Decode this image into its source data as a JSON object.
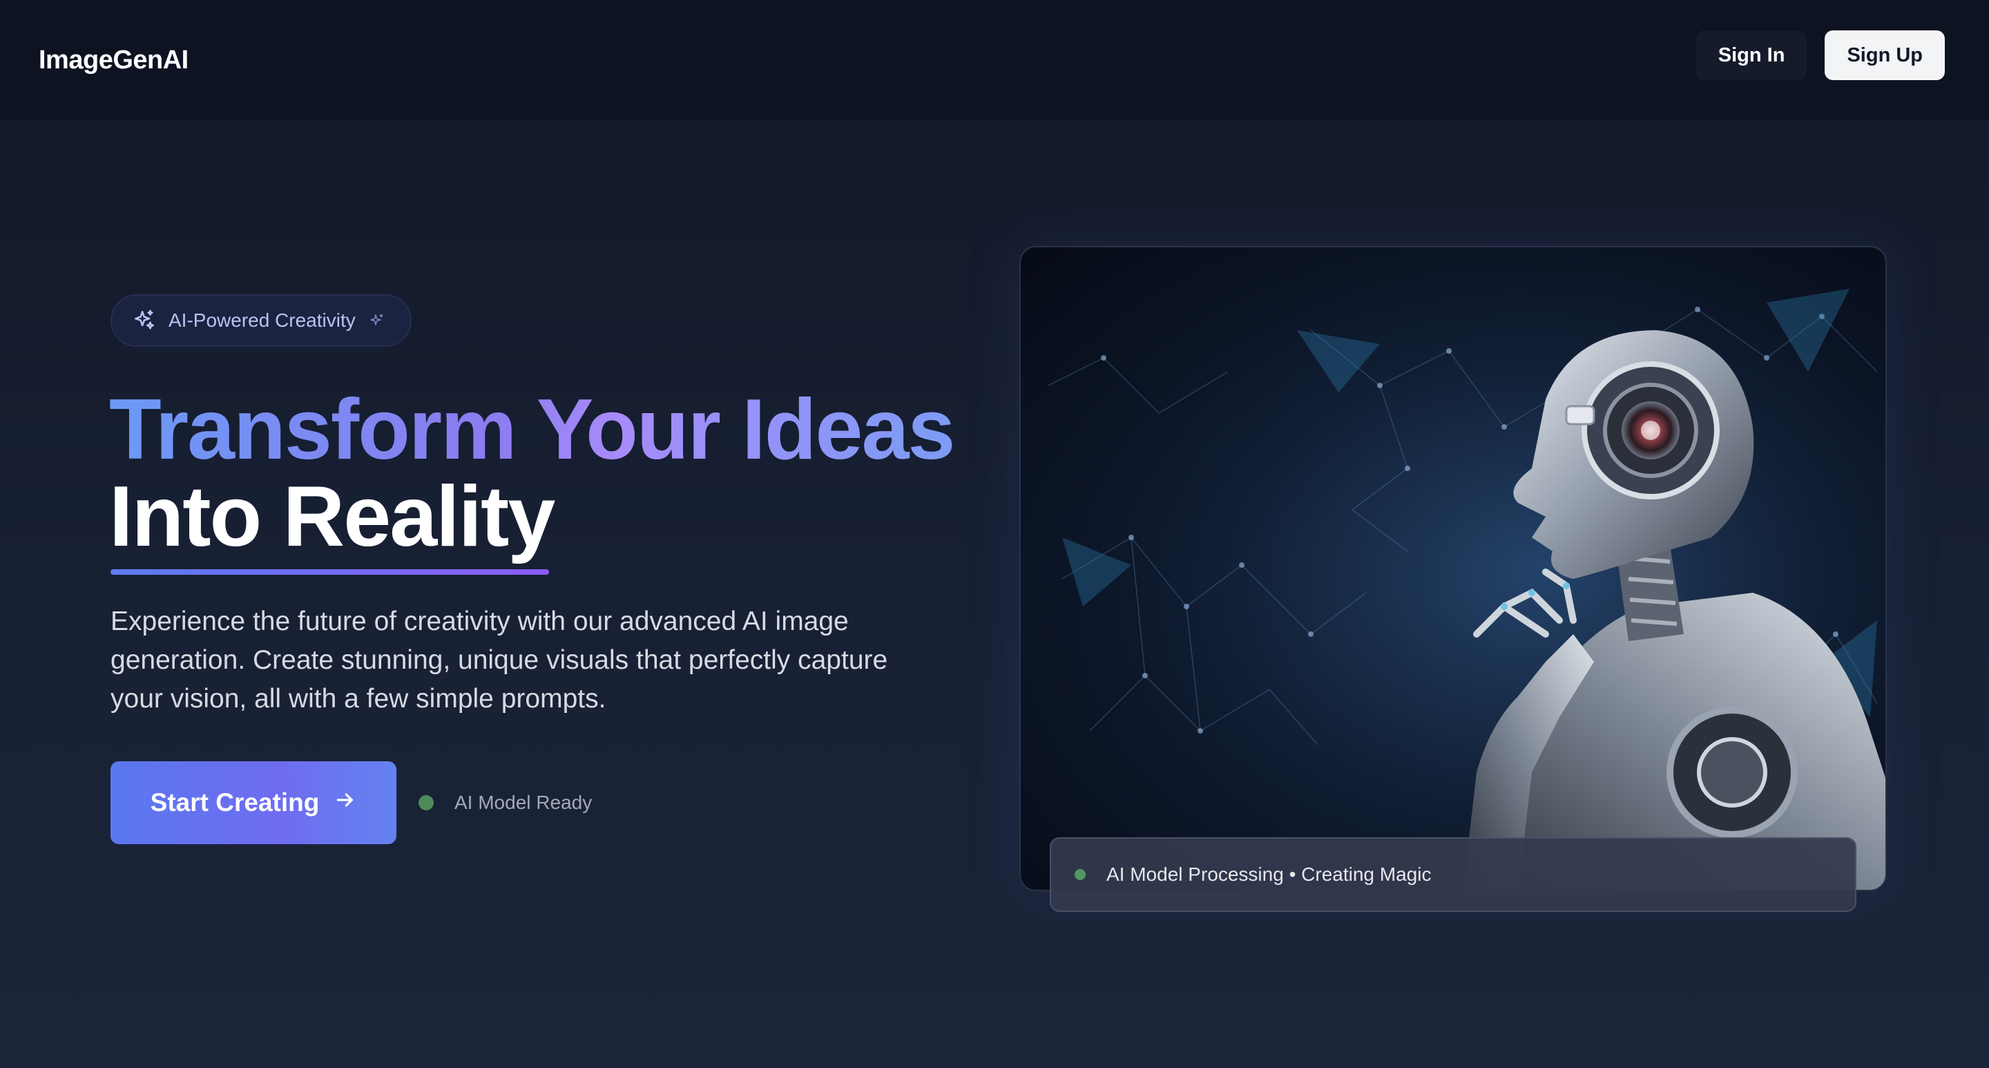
{
  "header": {
    "logo": "ImageGenAI",
    "sign_in": "Sign In",
    "sign_up": "Sign Up"
  },
  "hero": {
    "badge": {
      "label": "AI-Powered Creativity",
      "leading_icon": "sparkles-icon",
      "trailing_icon": "sparkle-icon"
    },
    "title_line1": "Transform Your Ideas",
    "title_line2": "Into Reality",
    "description": "Experience the future of creativity with our advanced AI image generation. Create stunning, unique visuals that perfectly capture your vision, all with a few simple prompts.",
    "cta_label": "Start Creating",
    "cta_icon": "arrow-right-icon",
    "status_text": "AI Model Ready"
  },
  "image_panel": {
    "caption": "AI Model Processing • Creating Magic",
    "image_subject": "humanoid robot in thinking pose"
  },
  "colors": {
    "background": "#141a2c",
    "header": "#0e1322",
    "accent_blue": "#5a78ef",
    "accent_purple": "#8b5cf6",
    "status_green": "#4f8a5a"
  }
}
